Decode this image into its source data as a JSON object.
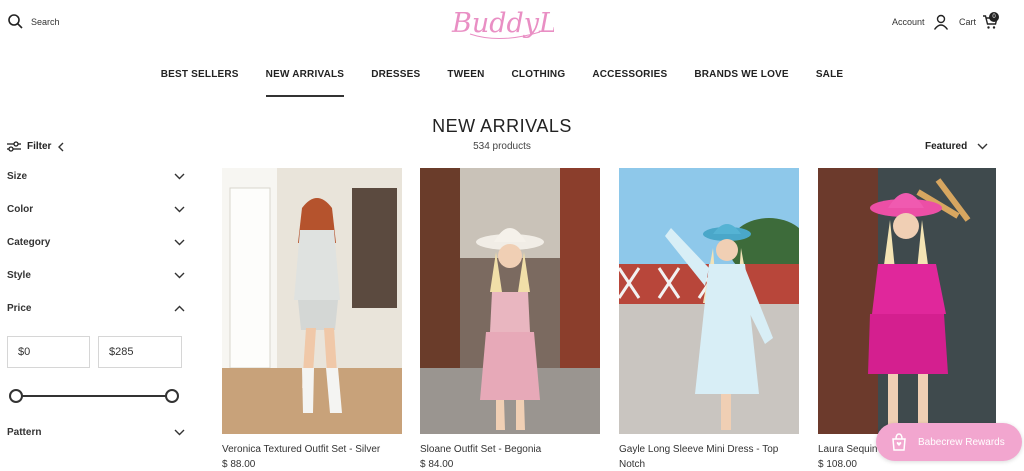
{
  "header": {
    "search_label": "Search",
    "logo_text": "BuddyLove",
    "account_label": "Account",
    "cart_label": "Cart",
    "cart_count": "0"
  },
  "nav": [
    "BEST SELLERS",
    "NEW ARRIVALS",
    "DRESSES",
    "TWEEN",
    "CLOTHING",
    "ACCESSORIES",
    "BRANDS WE LOVE",
    "SALE"
  ],
  "active_nav": "NEW ARRIVALS",
  "page": {
    "title": "NEW ARRIVALS",
    "count": "534 products",
    "sort_label": "Featured"
  },
  "sidebar": {
    "filter_label": "Filter",
    "facets": [
      "Size",
      "Color",
      "Category",
      "Style",
      "Price",
      "Pattern"
    ],
    "price_min": "$0",
    "price_max": "$285"
  },
  "products": [
    {
      "name": "Veronica Textured Outfit Set - Silver",
      "price": "$ 88.00"
    },
    {
      "name": "Sloane Outfit Set - Begonia",
      "price": "$ 84.00"
    },
    {
      "name": "Gayle Long Sleeve Mini Dress - Top",
      "name2": "Notch",
      "price": ""
    },
    {
      "name": "Laura Sequin",
      "price": "$ 108.00"
    }
  ],
  "rewards_label": "Babecrew Rewards",
  "colors": {
    "brand_pink": "#e98fc4",
    "rewards_pink": "#f2a6cf",
    "text": "#222222"
  }
}
